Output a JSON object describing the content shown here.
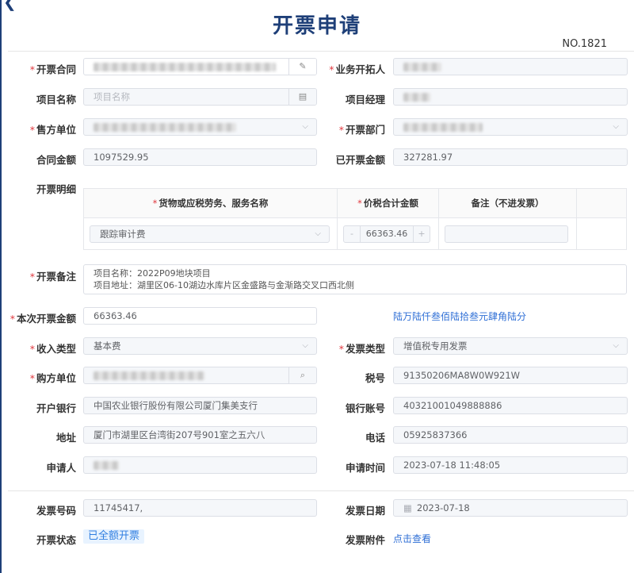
{
  "title": "开票申请",
  "no": "NO.1821",
  "required_mark": "*",
  "labels": {
    "contract": "开票合同",
    "developer": "业务开拓人",
    "project_name": "项目名称",
    "project_manager": "项目经理",
    "seller": "售方单位",
    "dept": "开票部门",
    "contract_amount": "合同金额",
    "invoiced_amount": "已开票金额",
    "details": "开票明细",
    "remark": "开票备注",
    "current_amount": "本次开票金额",
    "income_type": "收入类型",
    "invoice_type": "发票类型",
    "buyer": "购方单位",
    "tax_no": "税号",
    "bank": "开户银行",
    "account": "银行账号",
    "address": "地址",
    "phone": "电话",
    "applicant": "申请人",
    "apply_time": "申请时间",
    "invoice_no": "发票号码",
    "invoice_date": "发票日期",
    "status": "开票状态",
    "attachment": "发票附件"
  },
  "values": {
    "project_name_placeholder": "项目名称",
    "contract_amount": "1097529.95",
    "invoiced_amount": "327281.97",
    "current_amount": "66363.46",
    "amount_in_words": "陆万陆仟叁佰陆拾叁元肆角陆分",
    "income_type": "基本费",
    "invoice_type": "增值税专用发票",
    "tax_no": "91350206MA8W0W921W",
    "bank": "中国农业银行股份有限公司厦门集美支行",
    "account": "40321001049888886",
    "address": "厦门市湖里区台湾街207号901室之五六八",
    "phone": "05925837366",
    "apply_time": "2023-07-18 11:48:05",
    "invoice_no": "11745417,",
    "invoice_date": "2023-07-18",
    "status": "已全额开票",
    "attachment_link": "点击查看",
    "remark_line1": "项目名称：2022P09地块项目",
    "remark_line2": "项目地址：湖里区06-10湖边水库片区金盛路与金渐路交叉口西北侧"
  },
  "table": {
    "headers": [
      "货物或应税劳务、服务名称",
      "价税合计金额",
      "备注（不进发票）"
    ],
    "row": {
      "item": "跟踪审计费",
      "amount": "66363.46",
      "minus": "-",
      "plus": "+"
    }
  },
  "icons": {
    "edit": "edit-icon",
    "doc": "document-icon",
    "search": "search-icon",
    "calendar": "calendar-icon",
    "chevron": "chevron-down-icon"
  },
  "colors": {
    "title": "#1e3f78",
    "required": "#e0383e",
    "link": "#2f6fd6",
    "badge_bg": "#e8f3ff"
  }
}
